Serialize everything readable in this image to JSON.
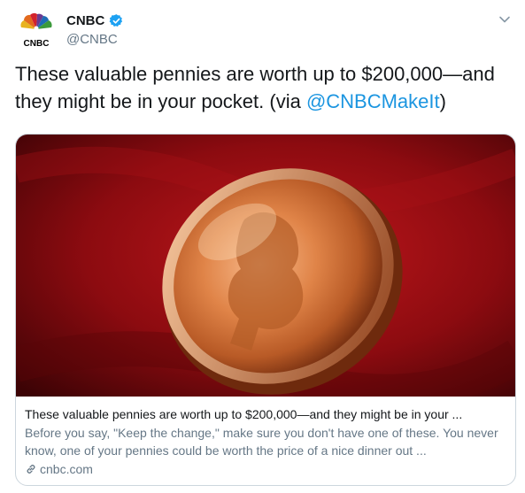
{
  "author": {
    "display_name": "CNBC",
    "handle": "@CNBC",
    "avatar_label": "CNBC",
    "verified": true,
    "avatar_icon": "cnbc-peacock-logo",
    "verified_icon": "verified-badge-icon"
  },
  "tweet": {
    "text_before": "These valuable pennies are worth up to $200,000—and they might be in your pocket. (via ",
    "mention": "@CNBCMakeIt",
    "text_after": ")"
  },
  "card": {
    "title": "These valuable pennies are worth up to $200,000—and they might be in your ...",
    "description": "Before you say, \"Keep the change,\" make sure you don't have one of these. You never know, one of your pennies could be worth the price of a nice dinner out ...",
    "domain": "cnbc.com",
    "link_icon": "link-icon",
    "image": "penny-photo"
  },
  "colors": {
    "text": "#14171a",
    "secondary": "#657786",
    "link": "#1b95e0",
    "verified": "#1da1f2",
    "border": "#ccd6dd"
  },
  "menu": {
    "caret_icon": "chevron-down-icon"
  }
}
